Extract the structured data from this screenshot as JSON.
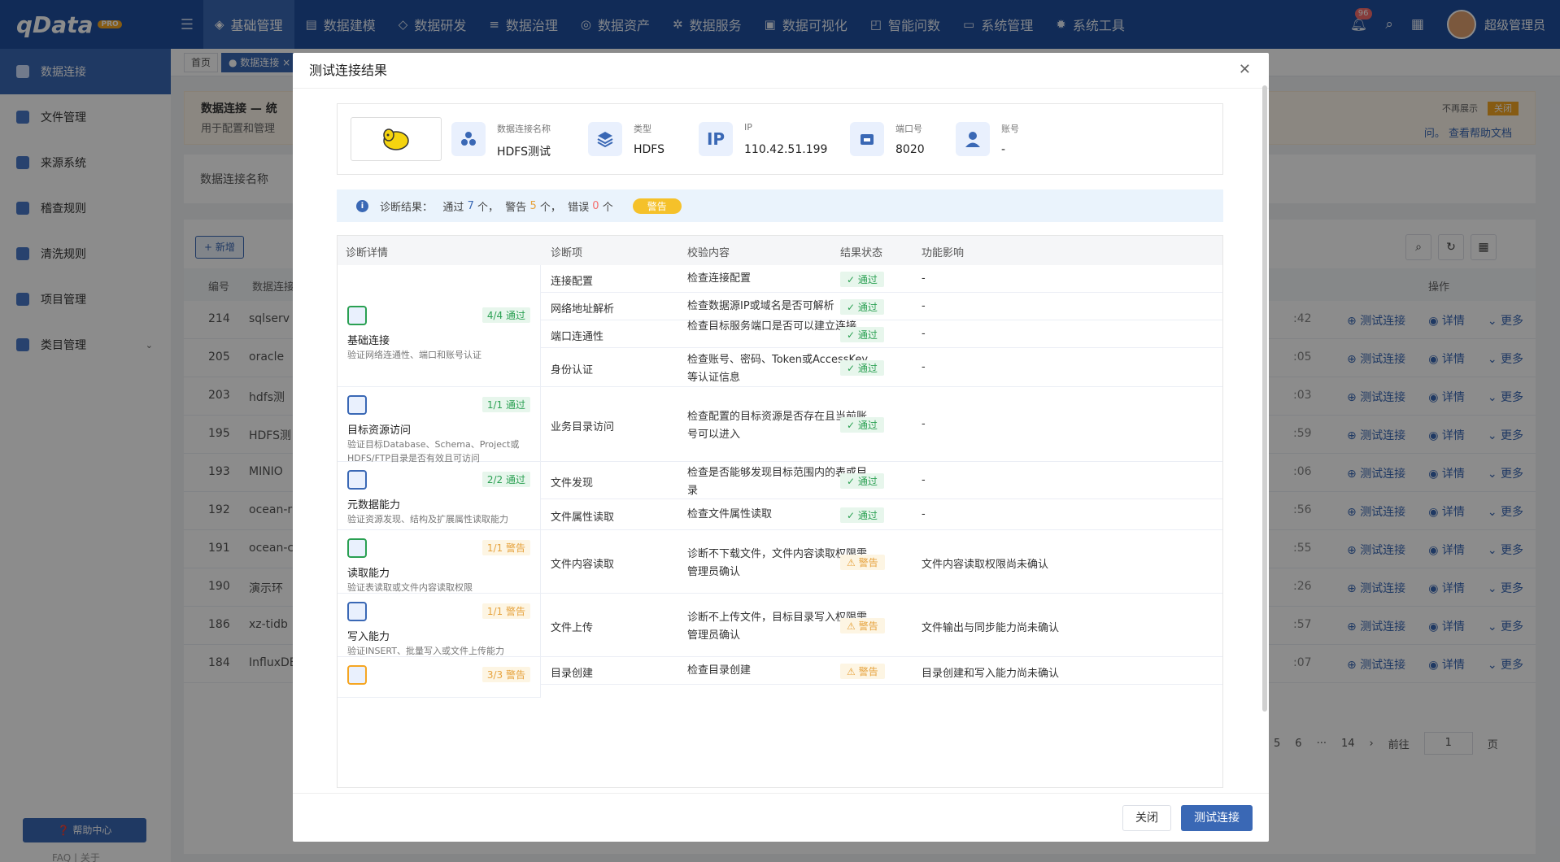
{
  "app": {
    "logo": "qData",
    "logo_badge": "PRO",
    "user": "超级管理员",
    "notif_count": "96"
  },
  "nav": [
    "基础管理",
    "数据建模",
    "数据研发",
    "数据治理",
    "数据资产",
    "数据服务",
    "数据可视化",
    "智能问数",
    "系统管理",
    "系统工具"
  ],
  "sidebar": {
    "items": [
      "数据连接",
      "文件管理",
      "来源系统",
      "稽查规则",
      "清洗规则",
      "项目管理",
      "类目管理"
    ],
    "help": "帮助中心",
    "links": "FAQ  |  关于"
  },
  "tabs": [
    "首页",
    "● 数据连接 ×"
  ],
  "notice": {
    "title": "数据连接 — 统",
    "desc": "用于配置和管理",
    "link": "问。 查看帮助文档",
    "hide": "不再展示",
    "close": "关闭"
  },
  "filter_label": "数据连接名称",
  "add_btn": "+ 新增",
  "table": {
    "headers": [
      "编号",
      "数据连接",
      "操作"
    ],
    "rows": [
      {
        "id": "214",
        "name": "sqlserv",
        "time": ":42"
      },
      {
        "id": "205",
        "name": "oracle",
        "time": ":05"
      },
      {
        "id": "203",
        "name": "hdfs测",
        "time": ":03"
      },
      {
        "id": "195",
        "name": "HDFS测",
        "time": ":59"
      },
      {
        "id": "193",
        "name": "MINIO",
        "time": ":06"
      },
      {
        "id": "192",
        "name": "ocean-r",
        "time": ":56"
      },
      {
        "id": "191",
        "name": "ocean-c",
        "time": ":55"
      },
      {
        "id": "190",
        "name": "演示环",
        "time": ":26"
      },
      {
        "id": "186",
        "name": "xz-tidb",
        "time": ":57"
      },
      {
        "id": "184",
        "name": "InfluxDE",
        "time": ":07"
      }
    ],
    "ops": {
      "test": "测试连接",
      "detail": "详情",
      "more": "更多"
    }
  },
  "pager": {
    "p5": "5",
    "p6": "6",
    "dots": "···",
    "p14": "14",
    "goto": "前往",
    "page": "1",
    "unit": "页"
  },
  "modal": {
    "title": "测试连接结果",
    "info": [
      {
        "label": "数据连接名称",
        "value": "HDFS测试"
      },
      {
        "label": "类型",
        "value": "HDFS"
      },
      {
        "label": "IP",
        "value": "110.42.51.199"
      },
      {
        "label": "端口号",
        "value": "8020"
      },
      {
        "label": "账号",
        "value": "-"
      }
    ],
    "diag": {
      "label": "诊断结果：",
      "pass_pre": "通过",
      "pass": "7",
      "pass_suf": "个，",
      "warn_pre": "警告",
      "warn": "5",
      "warn_suf": "个，",
      "err_pre": "错误",
      "err": "0",
      "err_suf": "个",
      "tag": "警告"
    },
    "headers": [
      "诊断详情",
      "诊断项",
      "校验内容",
      "结果状态",
      "功能影响"
    ],
    "groups": [
      {
        "title": "基础连接",
        "desc": "验证网络连通性、端口和账号认证",
        "badge": "4/4 通过",
        "kind": "pass"
      },
      {
        "title": "目标资源访问",
        "desc": "验证目标Database、Schema、Project或HDFS/FTP目录是否有效且可访问",
        "badge": "1/1 通过",
        "kind": "pass"
      },
      {
        "title": "元数据能力",
        "desc": "验证资源发现、结构及扩展属性读取能力",
        "badge": "2/2 通过",
        "kind": "pass"
      },
      {
        "title": "读取能力",
        "desc": "验证表读取或文件内容读取权限",
        "badge": "1/1 警告",
        "kind": "warn"
      },
      {
        "title": "写入能力",
        "desc": "验证INSERT、批量写入或文件上传能力",
        "badge": "1/1 警告",
        "kind": "warn"
      },
      {
        "title": "",
        "desc": "",
        "badge": "3/3 警告",
        "kind": "warn"
      }
    ],
    "rows": [
      {
        "item": "连接配置",
        "check": "检查连接配置",
        "status": "通过",
        "impact": "-",
        "kind": "pass"
      },
      {
        "item": "网络地址解析",
        "check": "检查数据源IP或域名是否可解析",
        "status": "通过",
        "impact": "-",
        "kind": "pass"
      },
      {
        "item": "端口连通性",
        "check": "检查目标服务端口是否可以建立连接",
        "status": "通过",
        "impact": "-",
        "kind": "pass"
      },
      {
        "item": "身份认证",
        "check": "检查账号、密码、Token或AccessKey等认证信息",
        "status": "通过",
        "impact": "-",
        "kind": "pass"
      },
      {
        "item": "业务目录访问",
        "check": "检查配置的目标资源是否存在且当前账号可以进入",
        "status": "通过",
        "impact": "-",
        "kind": "pass"
      },
      {
        "item": "文件发现",
        "check": "检查是否能够发现目标范围内的表或目录",
        "status": "通过",
        "impact": "-",
        "kind": "pass"
      },
      {
        "item": "文件属性读取",
        "check": "检查文件属性读取",
        "status": "通过",
        "impact": "-",
        "kind": "pass"
      },
      {
        "item": "文件内容读取",
        "check": "诊断不下载文件，文件内容读取权限需管理员确认",
        "status": "警告",
        "impact": "文件内容读取权限尚未确认",
        "kind": "warn"
      },
      {
        "item": "文件上传",
        "check": "诊断不上传文件，目标目录写入权限需管理员确认",
        "status": "警告",
        "impact": "文件输出与同步能力尚未确认",
        "kind": "warn"
      },
      {
        "item": "目录创建",
        "check": "检查目录创建",
        "status": "警告",
        "impact": "目录创建和写入能力尚未确认",
        "kind": "warn"
      }
    ],
    "close_btn": "关闭",
    "test_btn": "测试连接"
  },
  "colors": {
    "brand": "#1f4f9e",
    "accent": "#3a68b5",
    "pass": "#2aa052",
    "warn": "#e6a23c"
  }
}
